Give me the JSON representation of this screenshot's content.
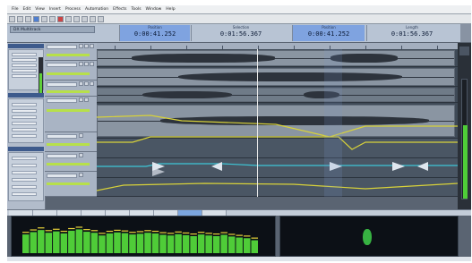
{
  "menu": {
    "items": [
      "File",
      "Edit",
      "View",
      "Insert",
      "Process",
      "Automation",
      "Effects",
      "Tools",
      "Window",
      "Help"
    ]
  },
  "session": {
    "title": "DX Multitrack"
  },
  "counters": [
    {
      "label": "Position",
      "value": "0:00:41.252",
      "highlight": true
    },
    {
      "label": "Selection",
      "value": "0:01:56.367",
      "highlight": false
    },
    {
      "label": "Position",
      "value": "0:00:41.252",
      "highlight": true
    },
    {
      "label": "Length",
      "value": "0:01:56.367",
      "highlight": false
    }
  ],
  "tracks": [
    {
      "name": "Track 1",
      "type": "audio"
    },
    {
      "name": "Track 2",
      "type": "audio"
    },
    {
      "name": "Track 3",
      "type": "audio"
    },
    {
      "name": "Track 4",
      "type": "audio"
    },
    {
      "name": "Track 5",
      "type": "envelope"
    },
    {
      "name": "Track 6",
      "type": "envelope"
    },
    {
      "name": "Track 7",
      "type": "envelope"
    }
  ],
  "bottom_tabs": [
    "Mixer",
    "Track FX",
    "Bus",
    "Markers",
    "Regions",
    "Video",
    "Explorer",
    "Spectrum",
    "Phase Scope"
  ],
  "active_tab_index": 7,
  "meters": {
    "master_level": 0.62,
    "left_small_level": 0.55
  },
  "spectrum_bars": [
    0.55,
    0.62,
    0.68,
    0.6,
    0.64,
    0.58,
    0.66,
    0.7,
    0.63,
    0.6,
    0.52,
    0.58,
    0.61,
    0.59,
    0.55,
    0.57,
    0.6,
    0.58,
    0.54,
    0.52,
    0.56,
    0.53,
    0.5,
    0.55,
    0.52,
    0.5,
    0.54,
    0.49,
    0.46,
    0.44,
    0.38
  ],
  "colors": {
    "accent": "#7ca6df",
    "meter_green": "#4fcc38",
    "peak_yellow": "#e8d23a",
    "envelope_yellow": "#d8d23a",
    "envelope_cyan": "#3ec6d6"
  }
}
